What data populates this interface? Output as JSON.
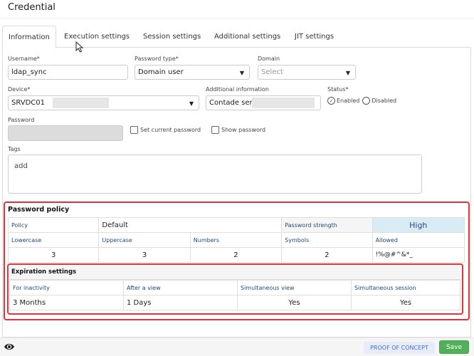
{
  "header": {
    "title": "Credential"
  },
  "tabs": [
    {
      "label": "Information",
      "active": true
    },
    {
      "label": "Execution settings"
    },
    {
      "label": "Session settings"
    },
    {
      "label": "Additional settings"
    },
    {
      "label": "JIT settings"
    }
  ],
  "form": {
    "username": {
      "label": "Username*",
      "value": "ldap_sync"
    },
    "password_type": {
      "label": "Password type*",
      "value": "Domain user"
    },
    "domain": {
      "label": "Domain",
      "placeholder": "Select"
    },
    "device": {
      "label": "Device*",
      "value": "SRVDC01"
    },
    "additional_info": {
      "label": "Additional information",
      "value": "Contade serviço"
    },
    "status": {
      "label": "Status*",
      "options": [
        "Enabled",
        "Disabled"
      ],
      "selected": "Enabled"
    },
    "password": {
      "label": "Password",
      "value": ""
    },
    "set_current_password": {
      "label": "Set current password",
      "checked": false
    },
    "show_password": {
      "label": "Show password",
      "checked": false
    },
    "tags": {
      "label": "Tags",
      "placeholder": "add"
    }
  },
  "password_policy": {
    "title": "Password policy",
    "policy_label": "Policy",
    "policy_value": "Default",
    "strength_label": "Password strength",
    "strength_value": "High",
    "columns": [
      "Lowercase",
      "Uppercase",
      "Numbers",
      "Symbols",
      "Allowed"
    ],
    "values": [
      "3",
      "3",
      "2",
      "2",
      "!%@#^&*_"
    ]
  },
  "expiration_settings": {
    "title": "Expiration settings",
    "columns": [
      "For inactivity",
      "After a view",
      "Simultaneous view",
      "Simultaneous session"
    ],
    "values": [
      "3 Months",
      "1 Days",
      "Yes",
      "Yes"
    ]
  },
  "footer": {
    "eye_icon": "eye-icon",
    "poc_label": "PROOF OF CONCEPT",
    "save_label": "Save"
  },
  "colors": {
    "highlight_outline": "#e0343a",
    "save_green": "#52b05a",
    "poc_blue": "#4a6fce",
    "strength_bg": "#d9ecf6"
  }
}
